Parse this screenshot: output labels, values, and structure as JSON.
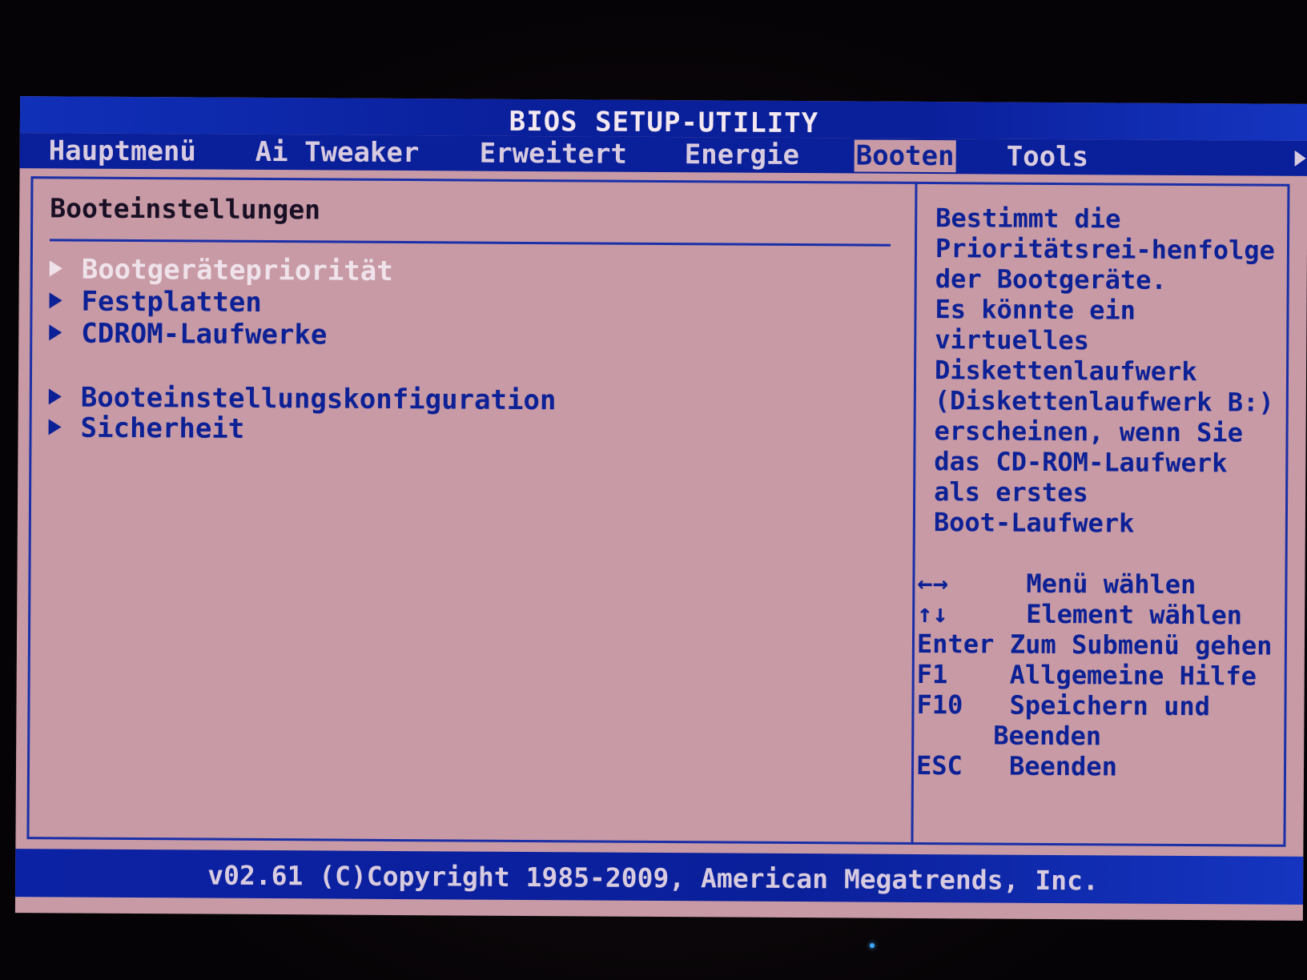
{
  "title": "BIOS SETUP-UTILITY",
  "tabs": [
    {
      "label": "Hauptmenü"
    },
    {
      "label": "Ai Tweaker"
    },
    {
      "label": "Erweitert"
    },
    {
      "label": "Energie"
    },
    {
      "label": "Booten",
      "active": true
    },
    {
      "label": "Tools"
    }
  ],
  "section": {
    "title": "Booteinstellungen"
  },
  "items": [
    {
      "label": "Bootgerätepriorität",
      "selected": true
    },
    {
      "label": "Festplatten"
    },
    {
      "label": "CDROM-Laufwerke"
    },
    {
      "label": "Booteinstellungskonfiguration"
    },
    {
      "label": "Sicherheit"
    }
  ],
  "help": {
    "lines": [
      "Bestimmt die",
      "Prioritätsrei-henfolge",
      "der Bootgeräte.",
      "Es könnte ein",
      "virtuelles",
      "Diskettenlaufwerk",
      "(Diskettenlaufwerk B:)",
      "erscheinen, wenn Sie",
      "das CD-ROM-Laufwerk",
      "als erstes",
      "Boot-Laufwerk"
    ]
  },
  "keys": [
    {
      "key": "←→",
      "desc": "Menü wählen"
    },
    {
      "key": "↑↓",
      "desc": "Element wählen"
    },
    {
      "key": "Enter",
      "desc": "Zum Submenü gehen"
    },
    {
      "key": "F1",
      "desc": "Allgemeine Hilfe"
    },
    {
      "key": "F10",
      "desc": "Speichern und"
    },
    {
      "key": "",
      "desc": "Beenden"
    },
    {
      "key": "ESC",
      "desc": "Beenden"
    }
  ],
  "footer": "v02.61 (C)Copyright 1985-2009, American Megatrends, Inc.",
  "colors": {
    "background": "#c79aa5",
    "bar": "#0a1f9a",
    "text": "#0d2196",
    "highlight": "#efe2ea"
  }
}
